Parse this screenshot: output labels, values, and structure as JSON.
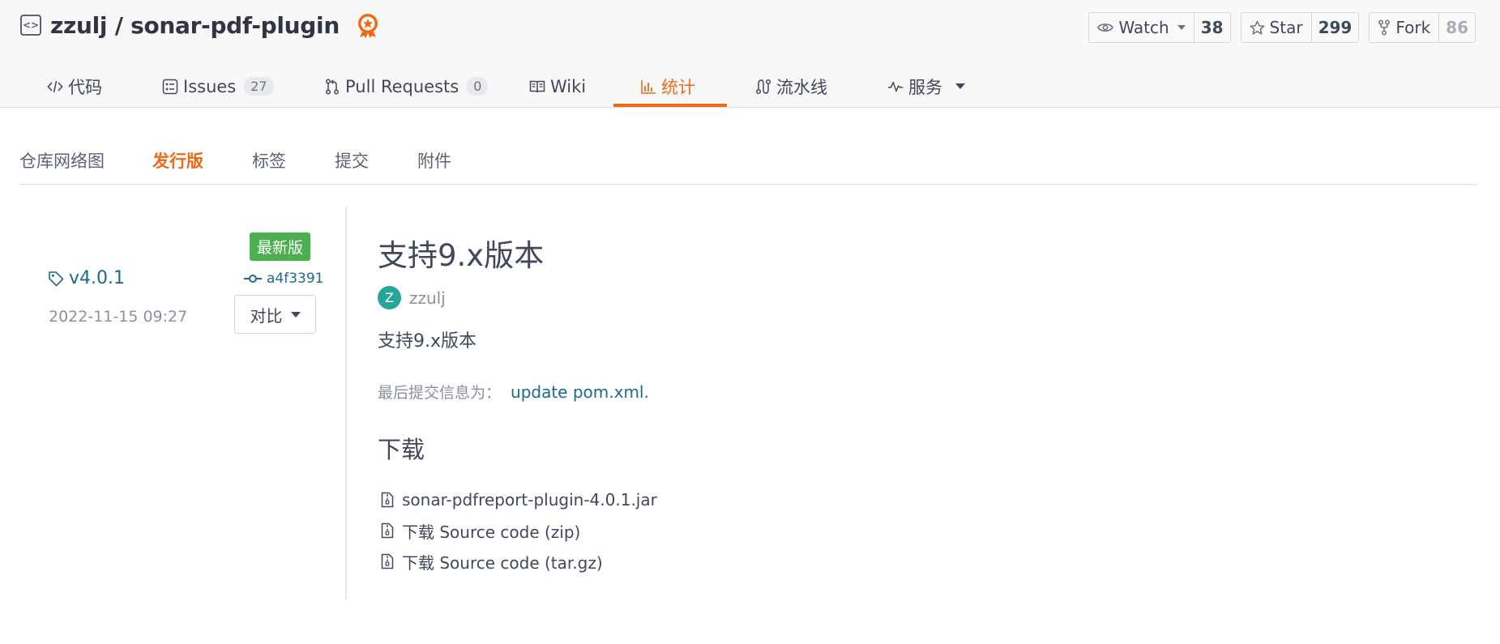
{
  "repo": {
    "owner": "zzulj",
    "separator": "/",
    "name": "sonar-pdf-plugin"
  },
  "actions": {
    "watch": {
      "label": "Watch",
      "count": "38"
    },
    "star": {
      "label": "Star",
      "count": "299"
    },
    "fork": {
      "label": "Fork",
      "count": "86"
    }
  },
  "nav": {
    "code": "代码",
    "issues": "Issues",
    "issues_count": "27",
    "pull_requests": "Pull Requests",
    "pull_requests_count": "0",
    "wiki": "Wiki",
    "stats": "统计",
    "pipeline": "流水线",
    "services": "服务"
  },
  "subtabs": {
    "network": "仓库网络图",
    "releases": "发行版",
    "tags": "标签",
    "commits": "提交",
    "attachments": "附件"
  },
  "release": {
    "latest_badge": "最新版",
    "tag": "v4.0.1",
    "commit": "a4f3391",
    "date": "2022-11-15 09:27",
    "compare": "对比",
    "title": "支持9.x版本",
    "author_initial": "Z",
    "author": "zzulj",
    "description": "支持9.x版本",
    "last_commit_label": "最后提交信息为：",
    "last_commit_message": "update pom.xml.",
    "downloads_heading": "下载",
    "downloads": [
      "sonar-pdfreport-plugin-4.0.1.jar",
      "下载 Source code (zip)",
      "下载 Source code (tar.gz)"
    ]
  },
  "colors": {
    "accent": "#f06a16",
    "link": "#1d6a8a",
    "latest_badge": "#4caf50",
    "avatar": "#26a69a"
  }
}
